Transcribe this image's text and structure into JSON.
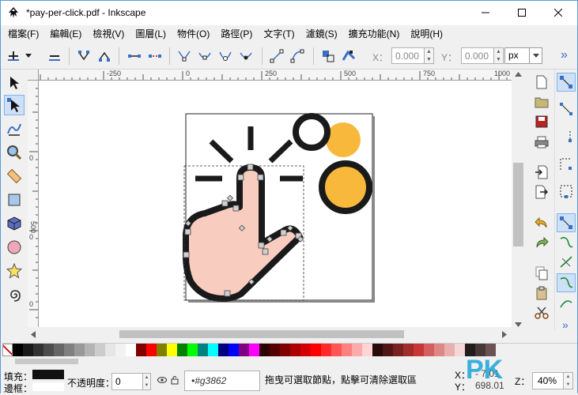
{
  "window": {
    "title": "*pay-per-click.pdf - Inkscape"
  },
  "menu": [
    "檔案(F)",
    "編輯(E)",
    "檢視(V)",
    "圖層(L)",
    "物件(O)",
    "路徑(P)",
    "文字(T)",
    "濾鏡(S)",
    "擴充功能(N)",
    "說明(H)"
  ],
  "toolbar": {
    "x_label": "X：",
    "x_value": "0.000",
    "y_label": "Y：",
    "y_value": "0.000",
    "unit": "px",
    "more": "»"
  },
  "rulers": {
    "top_ticks": [
      "-250",
      "0",
      "250",
      "500",
      "750",
      "1000"
    ],
    "left_ticks": [
      "0",
      "500",
      "0",
      "0"
    ]
  },
  "status": {
    "fill_label": "填充：",
    "stroke_label": "邊框：",
    "opacity_label": "不透明度：",
    "opacity_value": "0",
    "layer_value": "•#g3862",
    "message": "拖曳可選取節點，點擊可清除選取區",
    "x_label": "X：",
    "y_label": "Y：",
    "x_value": "- 7.01",
    "y_value": "698.01",
    "zoom_label": "Z：",
    "zoom_value": "40%"
  },
  "colors": {
    "hand_fill": "#f9ccc0",
    "stroke": "#1a1a1a",
    "accent_orange": "#f8b83c",
    "node_handle": "#d0d0d0",
    "watermark": "#1aa4d8"
  },
  "palette": [
    "#000000",
    "#1a1a1a",
    "#333333",
    "#4d4d4d",
    "#666666",
    "#808080",
    "#999999",
    "#b3b3b3",
    "#cccccc",
    "#e6e6e6",
    "#f2f2f2",
    "#ffffff",
    "#800000",
    "#ff0000",
    "#808000",
    "#ffff00",
    "#008000",
    "#00ff00",
    "#008080",
    "#00ffff",
    "#000080",
    "#0000ff",
    "#800080",
    "#ff00ff",
    "#2b0000",
    "#550000",
    "#800000",
    "#aa0000",
    "#d40000",
    "#ff0000",
    "#ff2a2a",
    "#ff5555",
    "#ff8080",
    "#ffaaaa",
    "#ffd5d5",
    "#280b0b",
    "#501616",
    "#782121",
    "#a02c2c",
    "#c83737",
    "#d35f5f",
    "#de8787",
    "#e9afaf",
    "#f4d7d7",
    "#241c1c",
    "#483737",
    "#6c5353"
  ],
  "watermark_text": "PK"
}
